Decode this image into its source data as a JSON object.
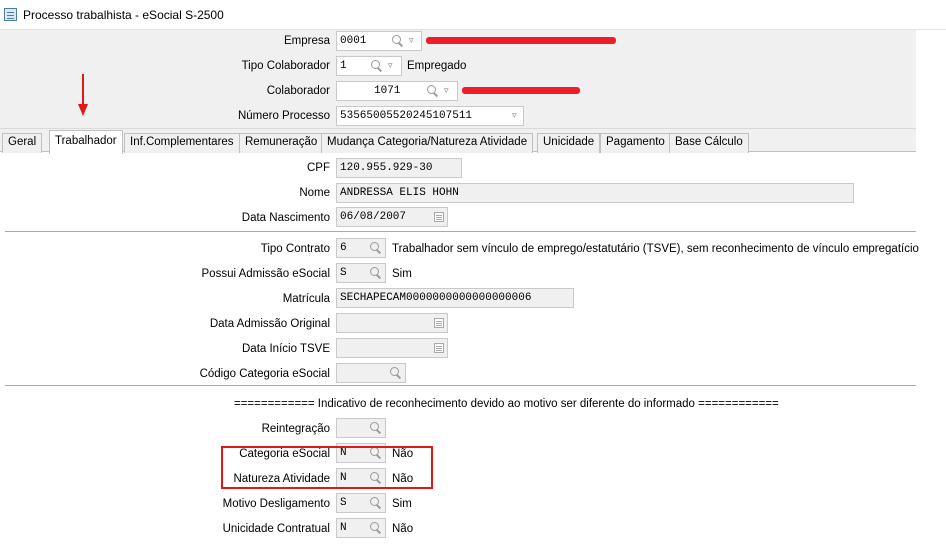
{
  "window": {
    "title": "Processo trabalhista - eSocial S-2500"
  },
  "header": {
    "empresa": {
      "label": "Empresa",
      "code": "0001"
    },
    "tipo_colaborador": {
      "label": "Tipo Colaborador",
      "code": "1",
      "desc": "Empregado"
    },
    "colaborador": {
      "label": "Colaborador",
      "code": "1071"
    },
    "numero_processo": {
      "label": "Número Processo",
      "value": "53565005520245107511"
    }
  },
  "tabs": [
    {
      "label": "Geral"
    },
    {
      "label": "Trabalhador"
    },
    {
      "label": "Inf.Complementares"
    },
    {
      "label": "Remuneração"
    },
    {
      "label": "Mudança Categoria/Natureza Atividade"
    },
    {
      "label": "Unicidade"
    },
    {
      "label": "Pagamento"
    },
    {
      "label": "Base Cálculo"
    }
  ],
  "active_tab": "Trabalhador",
  "worker": {
    "cpf": {
      "label": "CPF",
      "value": "120.955.929-30"
    },
    "nome": {
      "label": "Nome",
      "value": "ANDRESSA ELIS HOHN"
    },
    "data_nascimento": {
      "label": "Data Nascimento",
      "value": "06/08/2007"
    }
  },
  "contract": {
    "tipo_contrato": {
      "label": "Tipo Contrato",
      "code": "6",
      "desc": "Trabalhador sem vínculo de emprego/estatutário (TSVE), sem reconhecimento de vínculo empregatício"
    },
    "possui_admissao": {
      "label": "Possui Admissão eSocial",
      "code": "S",
      "desc": "Sim"
    },
    "matricula": {
      "label": "Matrícula",
      "value": "SECHAPECAM0000000000000000006"
    },
    "data_admissao_original": {
      "label": "Data Admissão Original",
      "value": ""
    },
    "data_inicio_tsve": {
      "label": "Data Início TSVE",
      "value": ""
    },
    "codigo_categoria": {
      "label": "Código Categoria eSocial",
      "value": ""
    }
  },
  "indicativo": {
    "heading": "============  Indicativo de reconhecimento devido ao motivo ser diferente do informado  ============",
    "reintegracao": {
      "label": "Reintegração",
      "code": ""
    },
    "categoria_esocial": {
      "label": "Categoria eSocial",
      "code": "N",
      "desc": "Não"
    },
    "natureza_atividade": {
      "label": "Natureza Atividade",
      "code": "N",
      "desc": "Não"
    },
    "motivo_desligamento": {
      "label": "Motivo Desligamento",
      "code": "S",
      "desc": "Sim"
    },
    "unicidade_contratual": {
      "label": "Unicidade Contratual",
      "code": "N",
      "desc": "Não"
    }
  },
  "colors": {
    "annotation": "#e01818",
    "redaction": "#ee1d2b",
    "panel": "#f0f0f0"
  },
  "icons": [
    "app-icon",
    "search-icon",
    "dropdown-icon",
    "calendar-icon"
  ]
}
